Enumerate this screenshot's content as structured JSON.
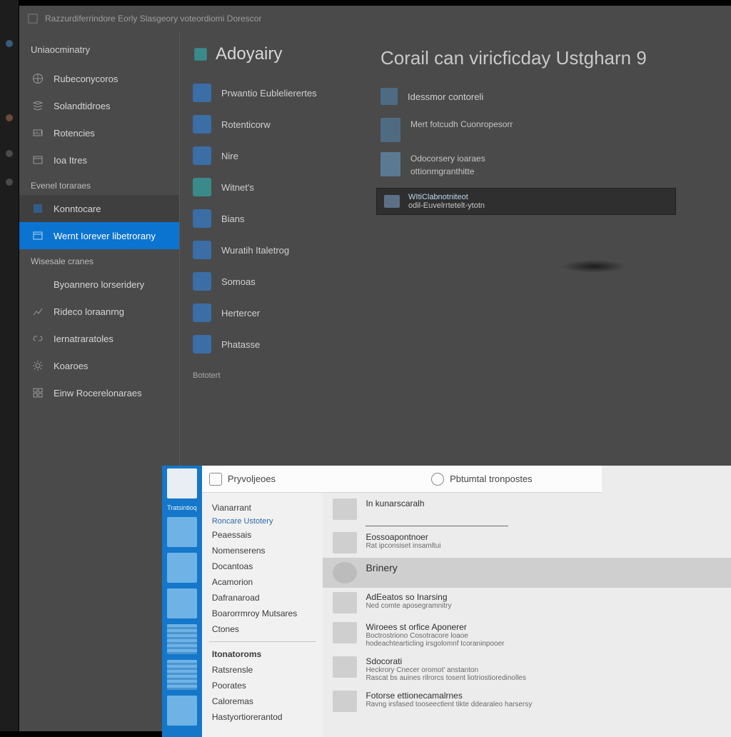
{
  "titlebar": {
    "text": "Razzurdiferrindore Eorly Slasgeory voteordiomi Dorescor"
  },
  "sidebar": {
    "header": "Uniaocminatry",
    "groups": [
      {
        "items": [
          {
            "icon": "globe-icon",
            "label": "Rubeconycoros"
          },
          {
            "icon": "stack-icon",
            "label": "Solandtidroes"
          },
          {
            "icon": "gauge-icon",
            "label": "Rotencies"
          },
          {
            "icon": "panel-icon",
            "label": "Ioa Itres"
          }
        ]
      },
      {
        "label": "Evenel toraraes",
        "items": [
          {
            "icon": "box-icon",
            "label": "Konntocare",
            "alt_bg": true
          },
          {
            "icon": "window-icon",
            "label": "Wernt Iorever libetrorany",
            "selected": true
          }
        ]
      },
      {
        "label": "Wisesale cranes",
        "items": [
          {
            "icon": "blank-icon",
            "label": "Byoannero lorseridery"
          },
          {
            "icon": "chart-icon",
            "label": "Rideco loraanrng"
          },
          {
            "icon": "link-icon",
            "label": "Iernatraratoles"
          },
          {
            "icon": "gear-icon",
            "label": "Koaroes"
          },
          {
            "icon": "grid-icon",
            "label": "Einw Rocerelonaraes"
          }
        ]
      }
    ]
  },
  "midcol": {
    "title": "Adoyairy",
    "items": [
      {
        "label": "Prwantio Eublelierertes"
      },
      {
        "label": "Rotenticorw"
      },
      {
        "label": "Nire"
      },
      {
        "label": "Witnet's",
        "teal": true
      },
      {
        "label": "Bians"
      },
      {
        "label": "Wuratih Italetrog"
      },
      {
        "label": "Somoas"
      },
      {
        "label": "Hertercer"
      },
      {
        "label": "Phatasse"
      }
    ],
    "section_label": "Bototert"
  },
  "content": {
    "heading": "Corail can viricficday Ustgharn 9",
    "row1": "Idessmor contoreli",
    "row2": "Mert fotcudh Cuonropesorr",
    "block_lines": [
      "Odocorsery ioaraes",
      "ottionmgranthitte"
    ],
    "popup_lines": [
      "WItiClabnotniteot",
      "odil-Euvelrrtetelt-ytotn"
    ]
  },
  "start": {
    "rail_caption": "Tratsintioq",
    "header_left": "Pryvoljeoes",
    "header_right": "Pbtumtal tronpostes",
    "list": [
      "Vianarrant",
      "Roncare Ustotery",
      "Peaessais",
      "Nomenserens",
      "Docantoas",
      "Acamorion",
      "Dafranaroad",
      "Boarorrmroy Mutsares",
      "Ctones",
      "Itonatoroms",
      "Ratsrensle",
      "Poorates",
      "Caloremas",
      "Hastyortiorerantod"
    ],
    "results": [
      {
        "t1": "In kunarscaralh",
        "t2": "",
        "t3": ""
      },
      {
        "t1": "Eossoapontnoer",
        "t2": "Rat ipconsiset insamltui",
        "t3": ""
      },
      {
        "t1": "Brinery",
        "selected": true
      },
      {
        "t1": "AdEeatos so Inarsing",
        "t2": "Ned comte aposegramnitry",
        "t3": ""
      },
      {
        "t1": "Wiroees st orfice Aponerer",
        "t2": "Boctrostriono Cosotracore loaoe",
        "t3": "hodeachtearticling irsgolomnf tcoraninpooer"
      },
      {
        "t1": "Sdocorati",
        "t2": "Heckrory Cnecer oromot' anstanton",
        "t3": "Rascat bs auines rilrorcs tosent liotriostioredinolles"
      },
      {
        "t1": "Fotorse ettionecamalrnes",
        "t2": "Ravng irsfased tooseectlent tikte ddearaleo harsersy",
        "t3": ""
      }
    ]
  }
}
